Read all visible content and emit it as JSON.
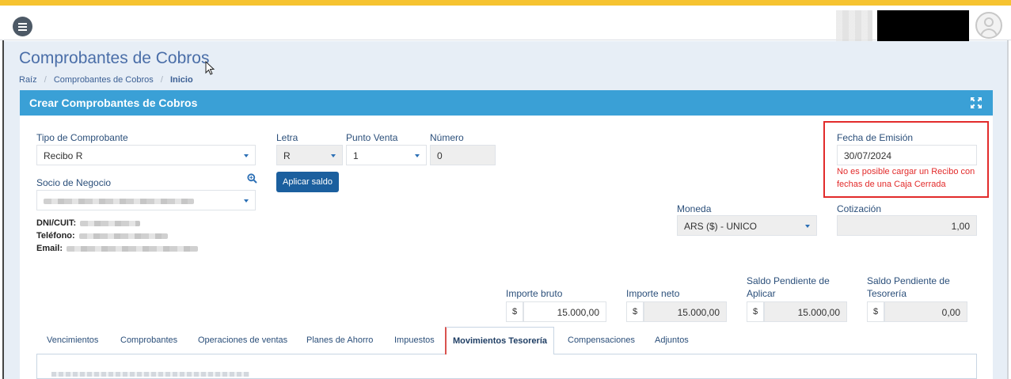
{
  "header": {
    "menu_icon": "hamburger-icon",
    "avatar_icon": "user-avatar-icon"
  },
  "page": {
    "title": "Comprobantes de Cobros",
    "breadcrumb": [
      "Raíz",
      "Comprobantes de Cobros",
      "Inicio"
    ]
  },
  "panel": {
    "title": "Crear Comprobantes de Cobros",
    "expand_icon": "expand-arrows-icon"
  },
  "form": {
    "tipo_comprobante": {
      "label": "Tipo de Comprobante",
      "value": "Recibo R"
    },
    "letra": {
      "label": "Letra",
      "value": "R"
    },
    "punto_venta": {
      "label": "Punto Venta",
      "value": "1"
    },
    "numero": {
      "label": "Número",
      "value": "0"
    },
    "aplicar_saldo_label": "Aplicar saldo",
    "socio_negocio": {
      "label": "Socio de Negocio"
    },
    "dni_label": "DNI/CUIT:",
    "telefono_label": "Teléfono:",
    "email_label": "Email:",
    "fecha_emision": {
      "label": "Fecha de Emisión",
      "value": "30/07/2024"
    },
    "error_message": "No es posible cargar un Recibo con fechas de una Caja Cerrada",
    "moneda": {
      "label": "Moneda",
      "value": "ARS ($) - UNICO"
    },
    "cotizacion": {
      "label": "Cotización",
      "value": "1,00"
    },
    "importe_bruto": {
      "label": "Importe bruto",
      "symbol": "$",
      "value": "15.000,00"
    },
    "importe_neto": {
      "label": "Importe neto",
      "symbol": "$",
      "value": "15.000,00"
    },
    "saldo_aplicar": {
      "label_1": "Saldo Pendiente de",
      "label_2": "Aplicar",
      "symbol": "$",
      "value": "15.000,00"
    },
    "saldo_tesoreria": {
      "label_1": "Saldo Pendiente de",
      "label_2": "Tesorería",
      "symbol": "$",
      "value": "0,00"
    }
  },
  "tabs": [
    {
      "label": "Vencimientos"
    },
    {
      "label": "Comprobantes"
    },
    {
      "label": "Operaciones de ventas"
    },
    {
      "label": "Planes de Ahorro"
    },
    {
      "label": "Impuestos"
    },
    {
      "label": "Movimientos Tesorería",
      "active": true
    },
    {
      "label": "Compensaciones"
    },
    {
      "label": "Adjuntos"
    }
  ],
  "colors": {
    "accent": "#3aa0d6",
    "topstripe": "#f6c330",
    "error": "#e22b2b",
    "primary_button": "#1b5f9e"
  }
}
